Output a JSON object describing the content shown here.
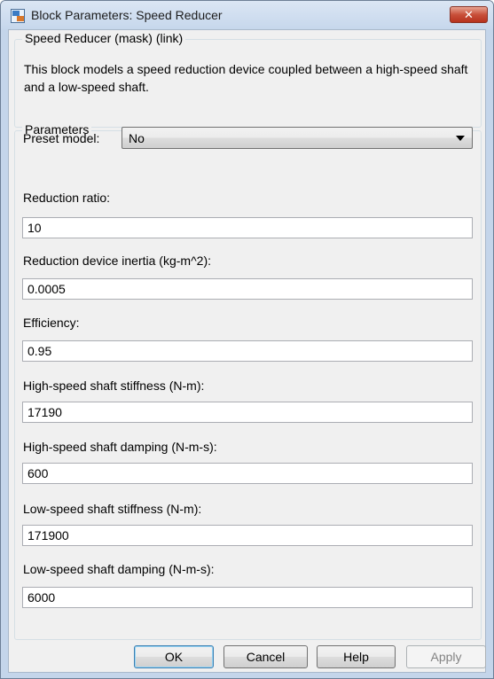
{
  "window": {
    "title": "Block Parameters: Speed Reducer",
    "close_glyph": "✕"
  },
  "mask": {
    "legend": "Speed Reducer (mask) (link)",
    "description": "This block models a speed reduction device coupled between a high-speed shaft and a low-speed shaft."
  },
  "parameters": {
    "legend": "Parameters",
    "preset_label": "Preset model:",
    "preset_value": "No",
    "fields": [
      {
        "label": "Reduction ratio:",
        "value": "10"
      },
      {
        "label": "Reduction device inertia (kg-m^2):",
        "value": "0.0005"
      },
      {
        "label": "Efficiency:",
        "value": "0.95"
      },
      {
        "label": "High-speed shaft stiffness (N-m):",
        "value": "17190"
      },
      {
        "label": "High-speed shaft damping (N-m-s):",
        "value": "600"
      },
      {
        "label": "Low-speed shaft stiffness (N-m):",
        "value": "171900"
      },
      {
        "label": "Low-speed shaft damping (N-m-s):",
        "value": "6000"
      }
    ]
  },
  "buttons": {
    "ok": "OK",
    "cancel": "Cancel",
    "help": "Help",
    "apply": "Apply"
  },
  "colors": {
    "frame": "#c4d5ea",
    "client": "#f0f0f0",
    "close": "#c8503a",
    "default_button_border": "#3c7fb1"
  },
  "icons": {
    "app": "simulink-block-icon",
    "close": "close-icon",
    "dropdown": "chevron-down-icon"
  }
}
